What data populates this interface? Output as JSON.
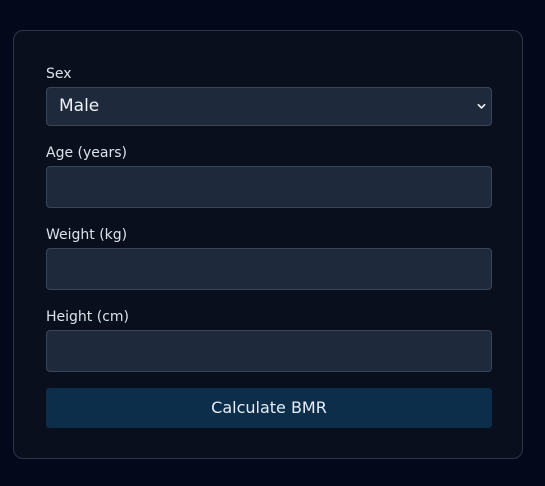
{
  "form": {
    "sex": {
      "label": "Sex",
      "selected": "Male",
      "icon": "chevron-down-icon"
    },
    "age": {
      "label": "Age (years)",
      "value": ""
    },
    "weight": {
      "label": "Weight (kg)",
      "value": ""
    },
    "height": {
      "label": "Height (cm)",
      "value": ""
    },
    "submit_label": "Calculate BMR"
  },
  "colors": {
    "page_background": "#03081a",
    "card_background": "#0a0f1e",
    "field_background": "#1e293b",
    "button_background": "#0c2e4b",
    "text": "#dde2ea"
  }
}
